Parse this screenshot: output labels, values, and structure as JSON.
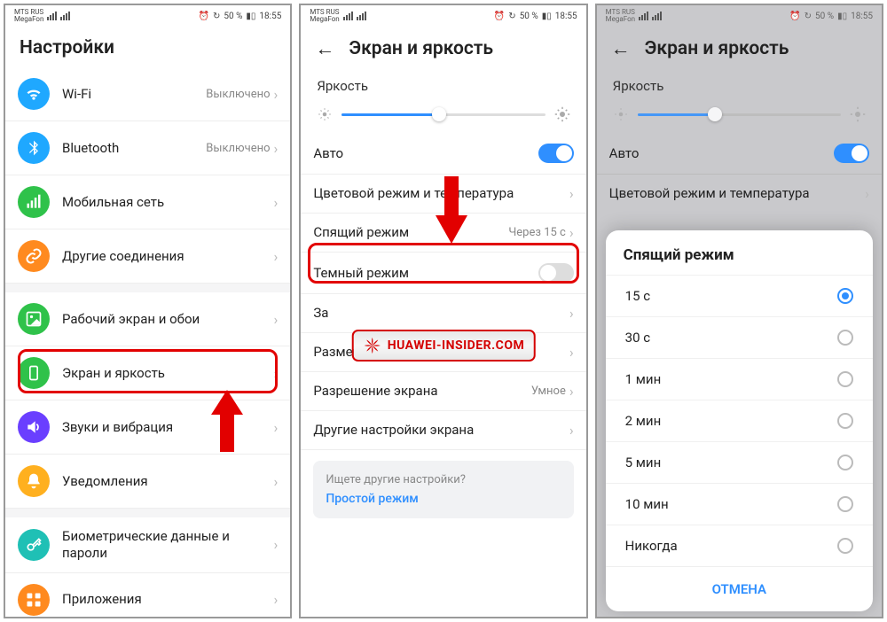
{
  "status": {
    "carrier1": "MTS RUS",
    "carrier2": "MegaFon",
    "battery": "50 %",
    "time": "18:55"
  },
  "screen1": {
    "title": "Настройки",
    "items": [
      {
        "label": "Wi-Fi",
        "value": "Выключено",
        "icon": "wifi",
        "color": "#1fa8ff"
      },
      {
        "label": "Bluetooth",
        "value": "Выключено",
        "icon": "bluetooth",
        "color": "#1fa8ff"
      },
      {
        "label": "Мобильная сеть",
        "value": "",
        "icon": "signal",
        "color": "#2fc24a"
      },
      {
        "label": "Другие соединения",
        "value": "",
        "icon": "link",
        "color": "#ff8a1f"
      },
      {
        "label": "Рабочий экран и обои",
        "value": "",
        "icon": "image",
        "color": "#2fc24a"
      },
      {
        "label": "Экран и яркость",
        "value": "",
        "icon": "display",
        "color": "#2fc24a"
      },
      {
        "label": "Звуки и вибрация",
        "value": "",
        "icon": "sound",
        "color": "#6a3fff"
      },
      {
        "label": "Уведомления",
        "value": "",
        "icon": "bell",
        "color": "#ffb01f"
      },
      {
        "label": "Биометрические данные и пароли",
        "value": "",
        "icon": "key",
        "color": "#1fc0b5"
      },
      {
        "label": "Приложения",
        "value": "",
        "icon": "apps",
        "color": "#ff8a1f"
      }
    ]
  },
  "screen2": {
    "title": "Экран и яркость",
    "brightness_label": "Яркость",
    "brightness_pct": 48,
    "auto_label": "Авто",
    "auto_on": true,
    "rows": [
      {
        "label": "Цветовой режим и температура",
        "value": ""
      },
      {
        "label": "Спящий режим",
        "value": "Через 15 с"
      },
      {
        "label": "Темный режим",
        "toggle": false
      },
      {
        "label": "За",
        "value": ""
      },
      {
        "label": "Размер текста и отображения",
        "value": ""
      },
      {
        "label": "Разрешение экрана",
        "value": "Умное"
      },
      {
        "label": "Другие настройки экрана",
        "value": ""
      }
    ],
    "hint_q": "Ищете другие настройки?",
    "hint_link": "Простой режим",
    "watermark": "HUAWEI-INSIDER.COM"
  },
  "screen3": {
    "title": "Экран и яркость",
    "brightness_label": "Яркость",
    "brightness_pct": 38,
    "auto_label": "Авто",
    "auto_on": true,
    "row_color": "Цветовой режим и температура",
    "sheet_title": "Спящий режим",
    "options": [
      "15 с",
      "30 с",
      "1 мин",
      "2 мин",
      "5 мин",
      "10 мин",
      "Никогда"
    ],
    "selected": 0,
    "cancel": "ОТМЕНА"
  }
}
